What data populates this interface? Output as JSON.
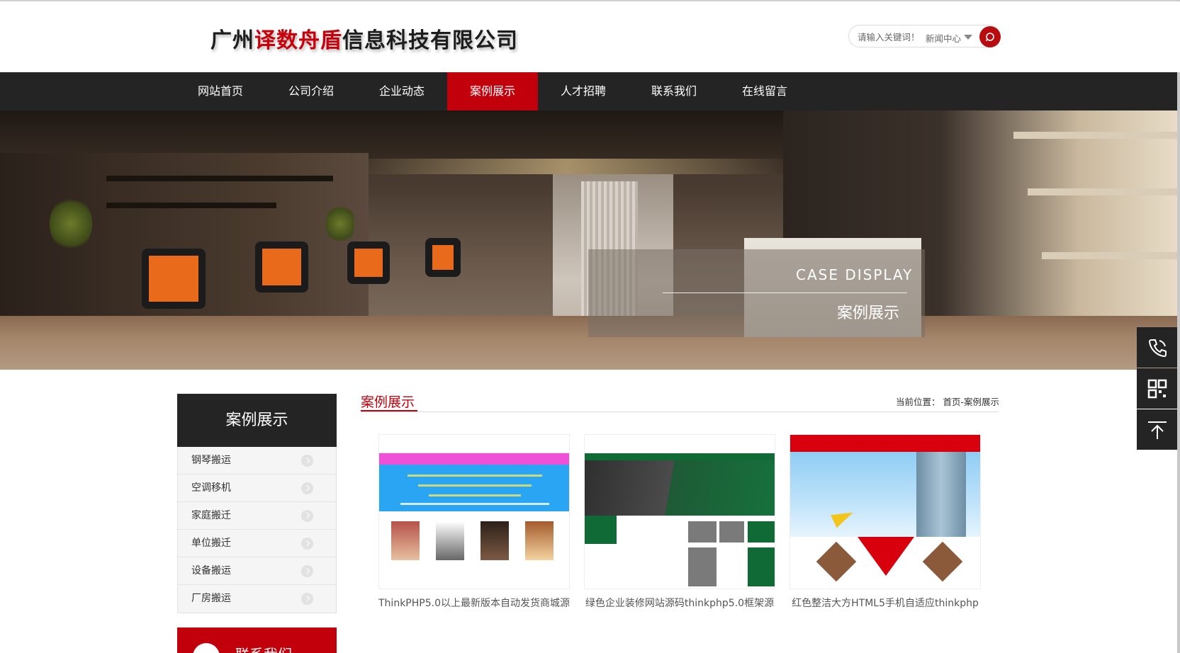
{
  "header": {
    "logo": {
      "part1": "广州",
      "part2": "译数舟盾",
      "part3": "信息科技有限公司"
    },
    "search": {
      "placeholder": "请输入关键词！",
      "category": "新闻中心"
    }
  },
  "nav": {
    "items": [
      "网站首页",
      "公司介绍",
      "企业动态",
      "案例展示",
      "人才招聘",
      "联系我们",
      "在线留言"
    ],
    "active": "案例展示"
  },
  "banner": {
    "en_title": "CASE DISPLAY",
    "zh_title": "案例展示"
  },
  "sidebar": {
    "title": "案例展示",
    "items": [
      "钢琴搬运",
      "空调移机",
      "家庭搬迁",
      "单位搬迁",
      "设备搬运",
      "厂房搬运"
    ],
    "contact_title": "联系我们"
  },
  "main": {
    "title": "案例展示",
    "breadcrumb": {
      "prefix": "当前位置：",
      "path": "首页-案例展示"
    },
    "cases": [
      {
        "caption": "ThinkPHP5.0以上最新版本自动发货商城源"
      },
      {
        "caption": "绿色企业装修网站源码thinkphp5.0框架源"
      },
      {
        "caption": "红色整洁大方HTML5手机自适应thinkphp"
      }
    ]
  },
  "float_tools": [
    "phone-icon",
    "qrcode-icon",
    "back-to-top-icon"
  ],
  "colors": {
    "accent": "#c2000c",
    "nav_bg": "#242424"
  }
}
